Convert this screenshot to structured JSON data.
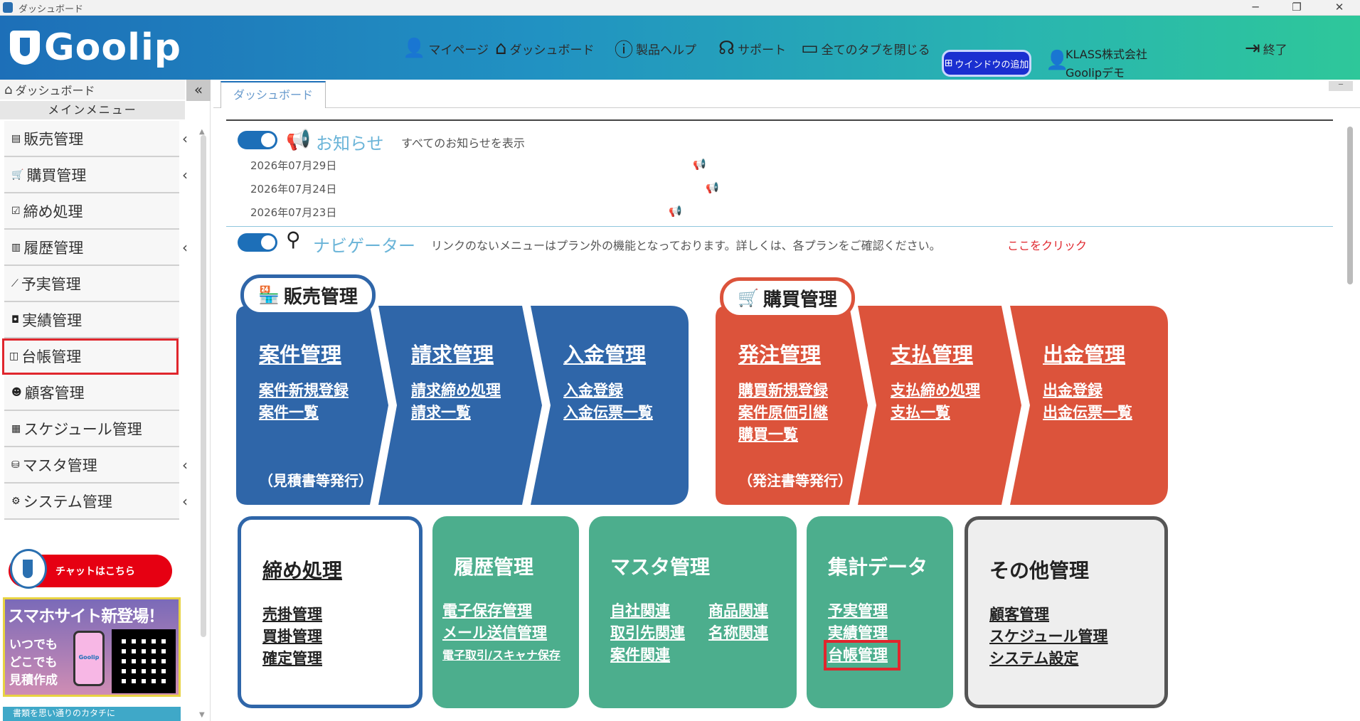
{
  "window": {
    "title": "ダッシュボード",
    "minimize": "─",
    "restore": "❐",
    "close": "✕"
  },
  "header": {
    "logo": "Goolip",
    "nav": [
      {
        "label": "マイページ",
        "icon": "user-icon"
      },
      {
        "label": "ダッシュボード",
        "icon": "house-icon"
      },
      {
        "label": "製品ヘルプ",
        "icon": "question-circle-icon"
      },
      {
        "label": "サポート",
        "icon": "headset-icon"
      },
      {
        "label": "全てのタブを閉じる",
        "icon": "window-icon"
      }
    ],
    "add_window": "ウインドウの追加",
    "company": "KLASS株式会社",
    "user": "Goolipデモ",
    "exit": "終了"
  },
  "sidebar": {
    "home": "ダッシュボード",
    "collapse": "«",
    "main_menu": "メインメニュー",
    "items": [
      {
        "label": "販売管理",
        "icon": "register-icon",
        "arrow": "‹"
      },
      {
        "label": "購買管理",
        "icon": "cart-icon",
        "arrow": "‹"
      },
      {
        "label": "締め処理",
        "icon": "checkbox-icon",
        "arrow": ""
      },
      {
        "label": "履歴管理",
        "icon": "book-icon",
        "arrow": "‹"
      },
      {
        "label": "予実管理",
        "icon": "chart-line-icon",
        "arrow": ""
      },
      {
        "label": "実績管理",
        "icon": "bookmark-icon",
        "arrow": ""
      },
      {
        "label": "台帳管理",
        "icon": "open-book-icon",
        "arrow": ""
      },
      {
        "label": "顧客管理",
        "icon": "users-icon",
        "arrow": ""
      },
      {
        "label": "スケジュール管理",
        "icon": "calendar-icon",
        "arrow": ""
      },
      {
        "label": "マスタ管理",
        "icon": "database-icon",
        "arrow": "‹"
      },
      {
        "label": "システム管理",
        "icon": "gear-icon",
        "arrow": "‹"
      }
    ],
    "chat": "チャットはこちら",
    "sp_banner": {
      "title": "スマホサイト新登場！",
      "line1": "いつでも",
      "line2": "どこでも",
      "line3": "見積作成",
      "phone_logo": "Goolip"
    },
    "bottom_banner": "書類を思い通りのカタチに"
  },
  "tabs": {
    "active": "ダッシュボード",
    "minimize": "─"
  },
  "notices": {
    "title": "お知らせ",
    "show_all": "すべてのお知らせを表示",
    "items": [
      {
        "date": "2026年07月29日"
      },
      {
        "date": "2026年07月24日"
      },
      {
        "date": "2026年07月23日"
      }
    ]
  },
  "navigator": {
    "title": "ナビゲーター",
    "note": "リンクのないメニューはプラン外の機能となっております。詳しくは、各プランをご確認ください。",
    "click_here": "ここをクリック",
    "sales_label": "販売管理",
    "purchase_label": "購買管理",
    "sales": [
      {
        "title": "案件管理",
        "links": [
          "案件新規登録",
          "案件一覧"
        ],
        "foot": "（見積書等発行）"
      },
      {
        "title": "請求管理",
        "links": [
          "請求締め処理",
          "請求一覧"
        ],
        "foot": ""
      },
      {
        "title": "入金管理",
        "links": [
          "入金登録",
          "入金伝票一覧"
        ],
        "foot": ""
      }
    ],
    "purchase": [
      {
        "title": "発注管理",
        "links": [
          "購買新規登録",
          "案件原価引継",
          "購買一覧"
        ],
        "foot": "（発注書等発行）"
      },
      {
        "title": "支払管理",
        "links": [
          "支払締め処理",
          "支払一覧"
        ],
        "foot": ""
      },
      {
        "title": "出金管理",
        "links": [
          "出金登録",
          "出金伝票一覧"
        ],
        "foot": ""
      }
    ],
    "closing": {
      "title": "締め処理",
      "links": [
        "売掛管理",
        "買掛管理",
        "確定管理"
      ]
    },
    "history": {
      "title": "履歴管理",
      "links": [
        "電子保存管理",
        "メール送信管理",
        "電子取引/スキャナ保存"
      ]
    },
    "master": {
      "title": "マスタ管理",
      "links_left": [
        "自社関連",
        "取引先関連",
        "案件関連"
      ],
      "links_right": [
        "商品関連",
        "名称関連"
      ]
    },
    "aggregate": {
      "title": "集計データ",
      "links": [
        "予実管理",
        "実績管理",
        "台帳管理"
      ]
    },
    "other": {
      "title": "その他管理",
      "links": [
        "顧客管理",
        "スケジュール管理",
        "システム設定"
      ]
    }
  },
  "colors": {
    "blue": "#2f66a9",
    "red": "#dc533b",
    "green": "#4cae8d",
    "highlight": "#e0262d"
  }
}
